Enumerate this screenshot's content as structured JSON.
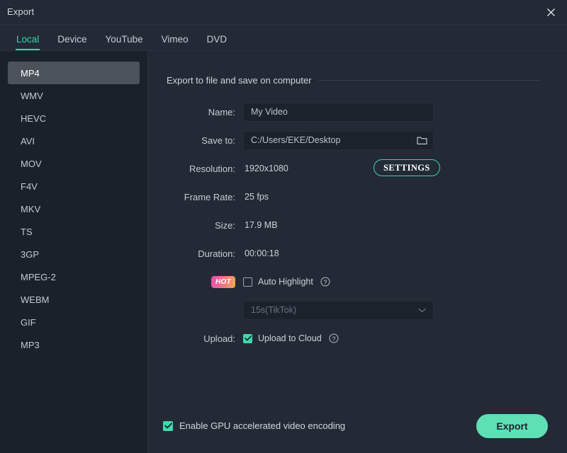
{
  "window": {
    "title": "Export",
    "close_icon": "close-icon"
  },
  "tabs": [
    {
      "label": "Local",
      "active": true
    },
    {
      "label": "Device",
      "active": false
    },
    {
      "label": "YouTube",
      "active": false
    },
    {
      "label": "Vimeo",
      "active": false
    },
    {
      "label": "DVD",
      "active": false
    }
  ],
  "formats": [
    {
      "label": "MP4",
      "selected": true
    },
    {
      "label": "WMV",
      "selected": false
    },
    {
      "label": "HEVC",
      "selected": false
    },
    {
      "label": "AVI",
      "selected": false
    },
    {
      "label": "MOV",
      "selected": false
    },
    {
      "label": "F4V",
      "selected": false
    },
    {
      "label": "MKV",
      "selected": false
    },
    {
      "label": "TS",
      "selected": false
    },
    {
      "label": "3GP",
      "selected": false
    },
    {
      "label": "MPEG-2",
      "selected": false
    },
    {
      "label": "WEBM",
      "selected": false
    },
    {
      "label": "GIF",
      "selected": false
    },
    {
      "label": "MP3",
      "selected": false
    }
  ],
  "main": {
    "section_title": "Export to file and save on computer",
    "name": {
      "label": "Name:",
      "value": "My Video",
      "placeholder": "My Video"
    },
    "save_to": {
      "label": "Save to:",
      "value": "C:/Users/EKE/Desktop",
      "placeholder": "C:/Users/EKE/Desktop",
      "browse_icon": "folder-icon"
    },
    "resolution": {
      "label": "Resolution:",
      "value": "1920x1080",
      "settings_button": "SETTINGS"
    },
    "frame_rate": {
      "label": "Frame Rate:",
      "value": "25 fps"
    },
    "size": {
      "label": "Size:",
      "value": "17.9 MB"
    },
    "duration": {
      "label": "Duration:",
      "value": "00:00:18"
    },
    "auto_highlight": {
      "badge": "HOT",
      "label": "Auto Highlight",
      "checked": false,
      "help_icon": "help-circle-icon"
    },
    "highlight_duration": {
      "value": "15s(TikTok)",
      "chevron_icon": "chevron-down-icon"
    },
    "upload": {
      "label": "Upload:",
      "checkbox_label": "Upload to Cloud",
      "checked": true,
      "help_icon": "help-circle-icon"
    }
  },
  "footer": {
    "gpu_label": "Enable GPU accelerated video encoding",
    "gpu_checked": true,
    "export_label": "Export"
  },
  "colors": {
    "accent": "#35d6ab",
    "export_button": "#5fe0b4",
    "checkbox_on": "#3fd9ac",
    "background": "#232a35",
    "sidebar": "#1b212b",
    "field": "#1c222c",
    "selected_item": "#4c525c",
    "hot_badge_from": "#e94bb0",
    "hot_badge_to": "#f0a84f"
  }
}
